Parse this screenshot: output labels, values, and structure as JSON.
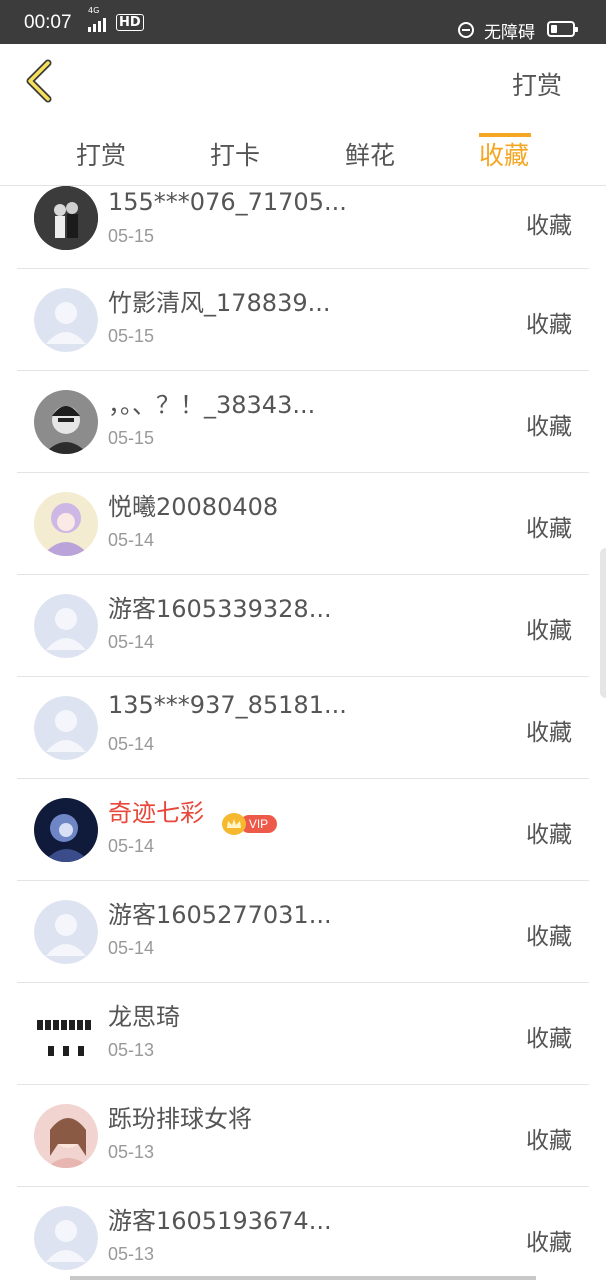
{
  "status_bar": {
    "time": "00:07",
    "network": "4G",
    "hd_label": "HD",
    "accessibility_text": "无障碍"
  },
  "header": {
    "right_action": "打赏"
  },
  "tabs": [
    {
      "label": "打赏"
    },
    {
      "label": "打卡"
    },
    {
      "label": "鲜花"
    },
    {
      "label": "收藏",
      "active": true
    }
  ],
  "accent_color": "#f5a623",
  "vip_name_color": "#e8473a",
  "list": [
    {
      "name": "155***076_71705...",
      "date": "05-15",
      "action": "收藏",
      "avatar": "photo-avatar-couple"
    },
    {
      "name": "竹影清风_178839...",
      "date": "05-15",
      "action": "收藏",
      "avatar": "default-avatar"
    },
    {
      "name": "，。、？！_38343...",
      "date": "05-15",
      "action": "收藏",
      "avatar": "photo-avatar-boy"
    },
    {
      "name": "悦曦20080408",
      "date": "05-14",
      "action": "收藏",
      "avatar": "anime-avatar"
    },
    {
      "name": "游客1605339328...",
      "date": "05-14",
      "action": "收藏",
      "avatar": "default-avatar"
    },
    {
      "name": "135***937_85181...",
      "date": "05-14",
      "action": "收藏",
      "avatar": "default-avatar"
    },
    {
      "name": "奇迹七彩",
      "date": "05-14",
      "action": "收藏",
      "avatar": "anime-dark-avatar",
      "vip_label": "VIP"
    },
    {
      "name": "游客1605277031...",
      "date": "05-14",
      "action": "收藏",
      "avatar": "default-avatar"
    },
    {
      "name": "龙思琦",
      "date": "05-13",
      "action": "收藏",
      "avatar": "group-photo-avatar"
    },
    {
      "name": "跞玢排球女将",
      "date": "05-13",
      "action": "收藏",
      "avatar": "photo-avatar-girl"
    },
    {
      "name": "游客1605193674...",
      "date": "05-13",
      "action": "收藏",
      "avatar": "default-avatar"
    }
  ]
}
